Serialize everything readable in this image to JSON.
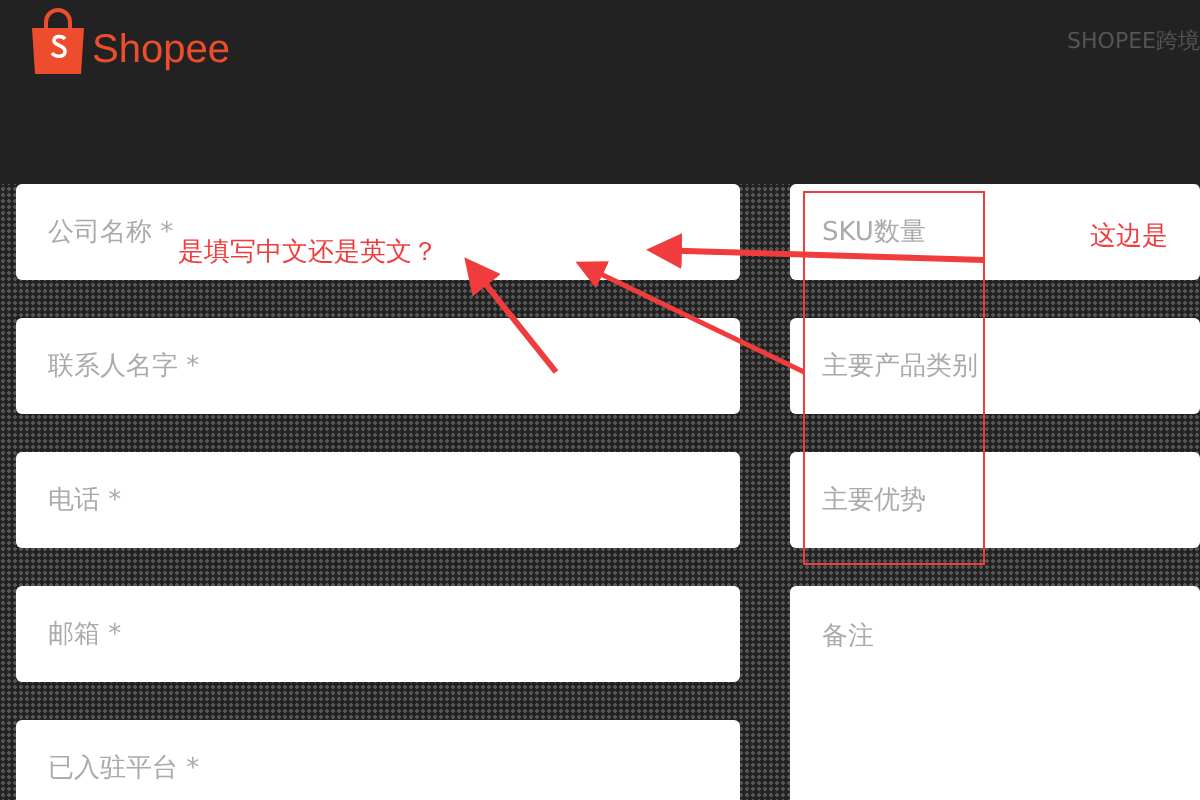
{
  "logo": {
    "text": "Shopee"
  },
  "header_link": "SHOPEE跨境",
  "form": {
    "left_fields": [
      {
        "placeholder": "公司名称 *"
      },
      {
        "placeholder": "联系人名字 *"
      },
      {
        "placeholder": "电话 *"
      },
      {
        "placeholder": "邮箱 *"
      },
      {
        "placeholder": "已入驻平台 *"
      }
    ],
    "right_fields": [
      {
        "kind": "input",
        "placeholder": "SKU数量"
      },
      {
        "kind": "input",
        "placeholder": "主要产品类别"
      },
      {
        "kind": "input",
        "placeholder": "主要优势"
      },
      {
        "kind": "textarea",
        "placeholder": "备注"
      }
    ]
  },
  "annotations": [
    {
      "text": "是填写中文还是英文？"
    },
    {
      "text": "这边是"
    }
  ]
}
